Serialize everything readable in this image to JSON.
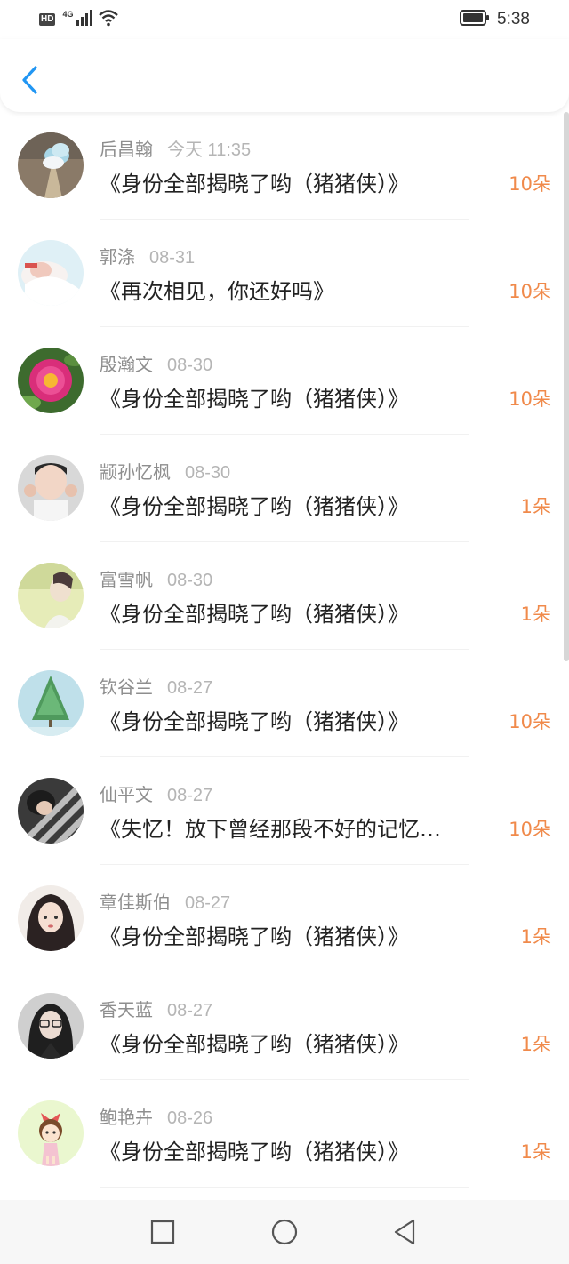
{
  "status_bar": {
    "hd_label": "HD",
    "network_label": "4G",
    "time": "5:38"
  },
  "header": {
    "back_icon": "chevron-left-icon",
    "accent_color": "#2196f3"
  },
  "flower_color": "#f08a4b",
  "items": [
    {
      "name": "后昌翰",
      "date": "今天 11:35",
      "title": "《身份全部揭晓了哟（猪猪侠）》",
      "flowers": "10朵"
    },
    {
      "name": "郭涤",
      "date": "08-31",
      "title": "《再次相见，你还好吗》",
      "flowers": "10朵"
    },
    {
      "name": "殷瀚文",
      "date": "08-30",
      "title": "《身份全部揭晓了哟（猪猪侠）》",
      "flowers": "10朵"
    },
    {
      "name": "颛孙忆枫",
      "date": "08-30",
      "title": "《身份全部揭晓了哟（猪猪侠）》",
      "flowers": "1朵"
    },
    {
      "name": "富雪帆",
      "date": "08-30",
      "title": "《身份全部揭晓了哟（猪猪侠）》",
      "flowers": "1朵"
    },
    {
      "name": "钦谷兰",
      "date": "08-27",
      "title": "《身份全部揭晓了哟（猪猪侠）》",
      "flowers": "10朵"
    },
    {
      "name": "仙平文",
      "date": "08-27",
      "title": "《失忆！放下曾经那段不好的记忆…",
      "flowers": "10朵"
    },
    {
      "name": "章佳斯伯",
      "date": "08-27",
      "title": "《身份全部揭晓了哟（猪猪侠）》",
      "flowers": "1朵"
    },
    {
      "name": "香天蓝",
      "date": "08-27",
      "title": "《身份全部揭晓了哟（猪猪侠）》",
      "flowers": "1朵"
    },
    {
      "name": "鲍艳卉",
      "date": "08-26",
      "title": "《身份全部揭晓了哟（猪猪侠）》",
      "flowers": "1朵"
    }
  ],
  "nav_bar": {
    "recent_icon": "square-icon",
    "home_icon": "circle-icon",
    "back_icon": "triangle-back-icon"
  }
}
